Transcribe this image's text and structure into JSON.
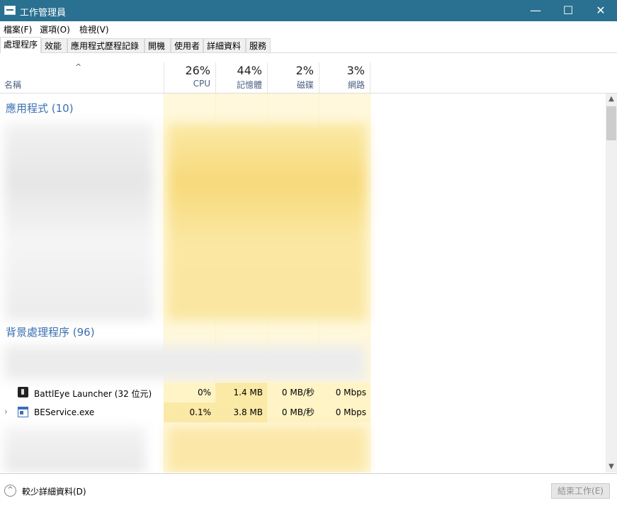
{
  "window": {
    "title": "工作管理員",
    "min": "—",
    "max": "☐",
    "close": "✕"
  },
  "menu": [
    "檔案(F)",
    "選項(O)",
    "檢視(V)"
  ],
  "tabs": [
    "處理程序",
    "效能",
    "應用程式歷程記錄",
    "開機",
    "使用者",
    "詳細資料",
    "服務"
  ],
  "header": {
    "sort_indicator": "^",
    "name_label": "名稱",
    "columns": [
      {
        "pct": "26%",
        "label": "CPU"
      },
      {
        "pct": "44%",
        "label": "記憶體"
      },
      {
        "pct": "2%",
        "label": "磁碟"
      },
      {
        "pct": "3%",
        "label": "網路"
      }
    ]
  },
  "groups": {
    "apps": "應用程式 (10)",
    "background": "背景處理程序 (96)"
  },
  "rows": [
    {
      "name": "BattlEye Launcher (32 位元)",
      "expander": "",
      "cpu": "0%",
      "memory": "1.4 MB",
      "disk": "0 MB/秒",
      "network": "0 Mbps"
    },
    {
      "name": "BEService.exe",
      "expander": "›",
      "cpu": "0.1%",
      "memory": "3.8 MB",
      "disk": "0 MB/秒",
      "network": "0 Mbps"
    }
  ],
  "scroll": {
    "up": "▲",
    "down": "▼"
  },
  "footer": {
    "fewer_icon": "^",
    "fewer_details": "較少詳細資料(D)",
    "end_task": "結束工作(E)"
  },
  "colors": {
    "titlebar": "#2a7090",
    "heat": "#fff8dc",
    "heat_row": "#ffeeb5",
    "group_text": "#3a6fb0"
  }
}
